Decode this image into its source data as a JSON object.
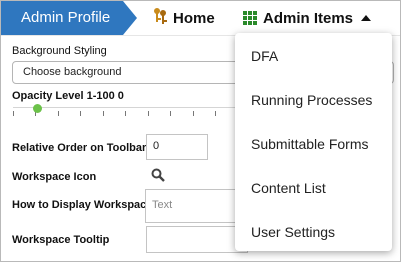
{
  "nav": {
    "breadcrumb": "Admin Profile",
    "home_label": "Home",
    "items_label": "Admin Items"
  },
  "form": {
    "bg_styling_label": "Background Styling",
    "bg_select_value": "Choose background",
    "opacity_label": "Opacity Level 1-100",
    "opacity_value": "0",
    "order_label": "Relative Order on Toolbar",
    "order_value": "0",
    "icon_label": "Workspace Icon",
    "display_label": "How to Display Workspace",
    "display_value": "Text",
    "tooltip_label": "Workspace Tooltip",
    "tooltip_value": ""
  },
  "menu": {
    "items": [
      "DFA",
      "Running Processes",
      "Submittable Forms",
      "Content List",
      "User Settings"
    ]
  },
  "colors": {
    "breadcrumb_bg": "#2f77bf",
    "slider_knob": "#6cc24a",
    "grid_icon": "#2a8a2a"
  }
}
